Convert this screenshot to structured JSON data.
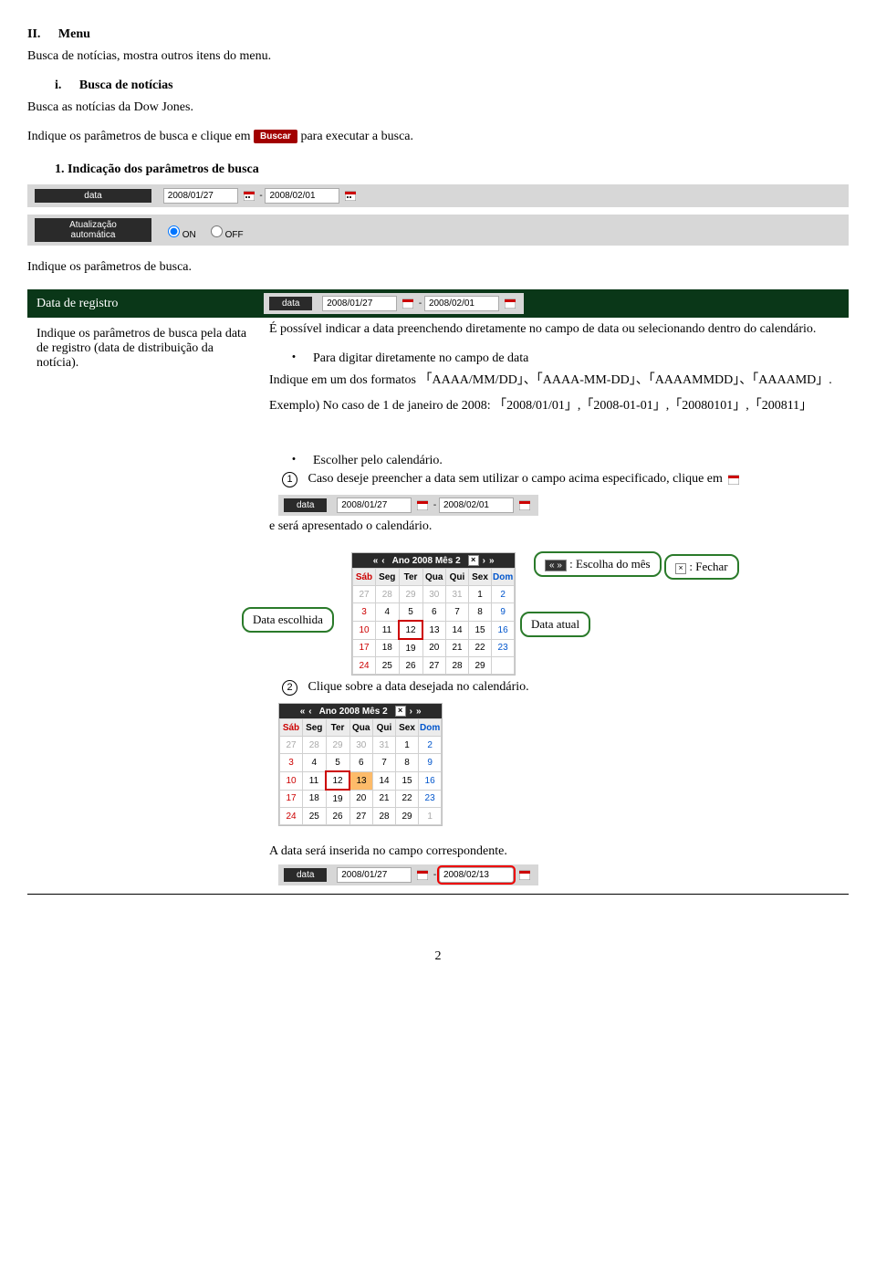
{
  "h2_num": "II.",
  "h2_title": "Menu",
  "p1": "Busca de notícias, mostra outros itens do menu.",
  "h3i_num": "i.",
  "h3i_title": "Busca de notícias",
  "p2": "Busca as notícias da Dow Jones.",
  "p3a": "Indique os parâmetros de busca e clique em",
  "buscar": "Buscar",
  "p3b": "para executar a busca.",
  "h4_num": "1.",
  "h4_title": "Indicação dos parâmetros de busca",
  "ui": {
    "data_label": "data",
    "date_from": "2008/01/27",
    "date_to": "2008/02/01",
    "sep": "-",
    "auto_label": "Atualização automática",
    "on": "ON",
    "off": "OFF"
  },
  "p4": "Indique os parâmetros de busca.",
  "def_header": "Data de registro",
  "def_left": "Indique os parâmetros de busca pela data de registro (data de distribuição da notícia).",
  "def_r1": "É possível indicar a data preenchendo diretamente no campo de data ou selecionando dentro do calendário.",
  "def_r2_bullet": "Para digitar diretamente no campo de data",
  "def_r3": "Indique em um dos formatos 「AAAA/MM/DD」、「AAAA-MM-DD」、「AAAAMMDD」、「AAAAMD」.",
  "def_r4": "Exemplo) No caso de 1 de janeiro de 2008: 「2008/01/01」,「2008-01-01」,「20080101」,「200811」",
  "def_r5_bullet": "Escolher pelo calendário.",
  "def_r6": "Caso deseje preencher a data sem utilizar o campo acima especificado, clique em",
  "def_r7": "e será apresentado o calendário.",
  "callout_data_escolhida": "Data escolhida",
  "callout_escolha_mes": ": Escolha do mês",
  "callout_fechar": ": Fechar",
  "callout_data_atual": "Data atual",
  "def_r8": "Clique sobre a data desejada no calendário.",
  "def_r9": "A data será inserida no campo correspondente.",
  "date_to2": "2008/02/13",
  "cal": {
    "title": "Ano 2008 Mês 2",
    "days": [
      "Sáb",
      "Seg",
      "Ter",
      "Qua",
      "Qui",
      "Sex",
      "Dom"
    ]
  },
  "pagenum": "2",
  "circ1": "1",
  "circ2": "2"
}
